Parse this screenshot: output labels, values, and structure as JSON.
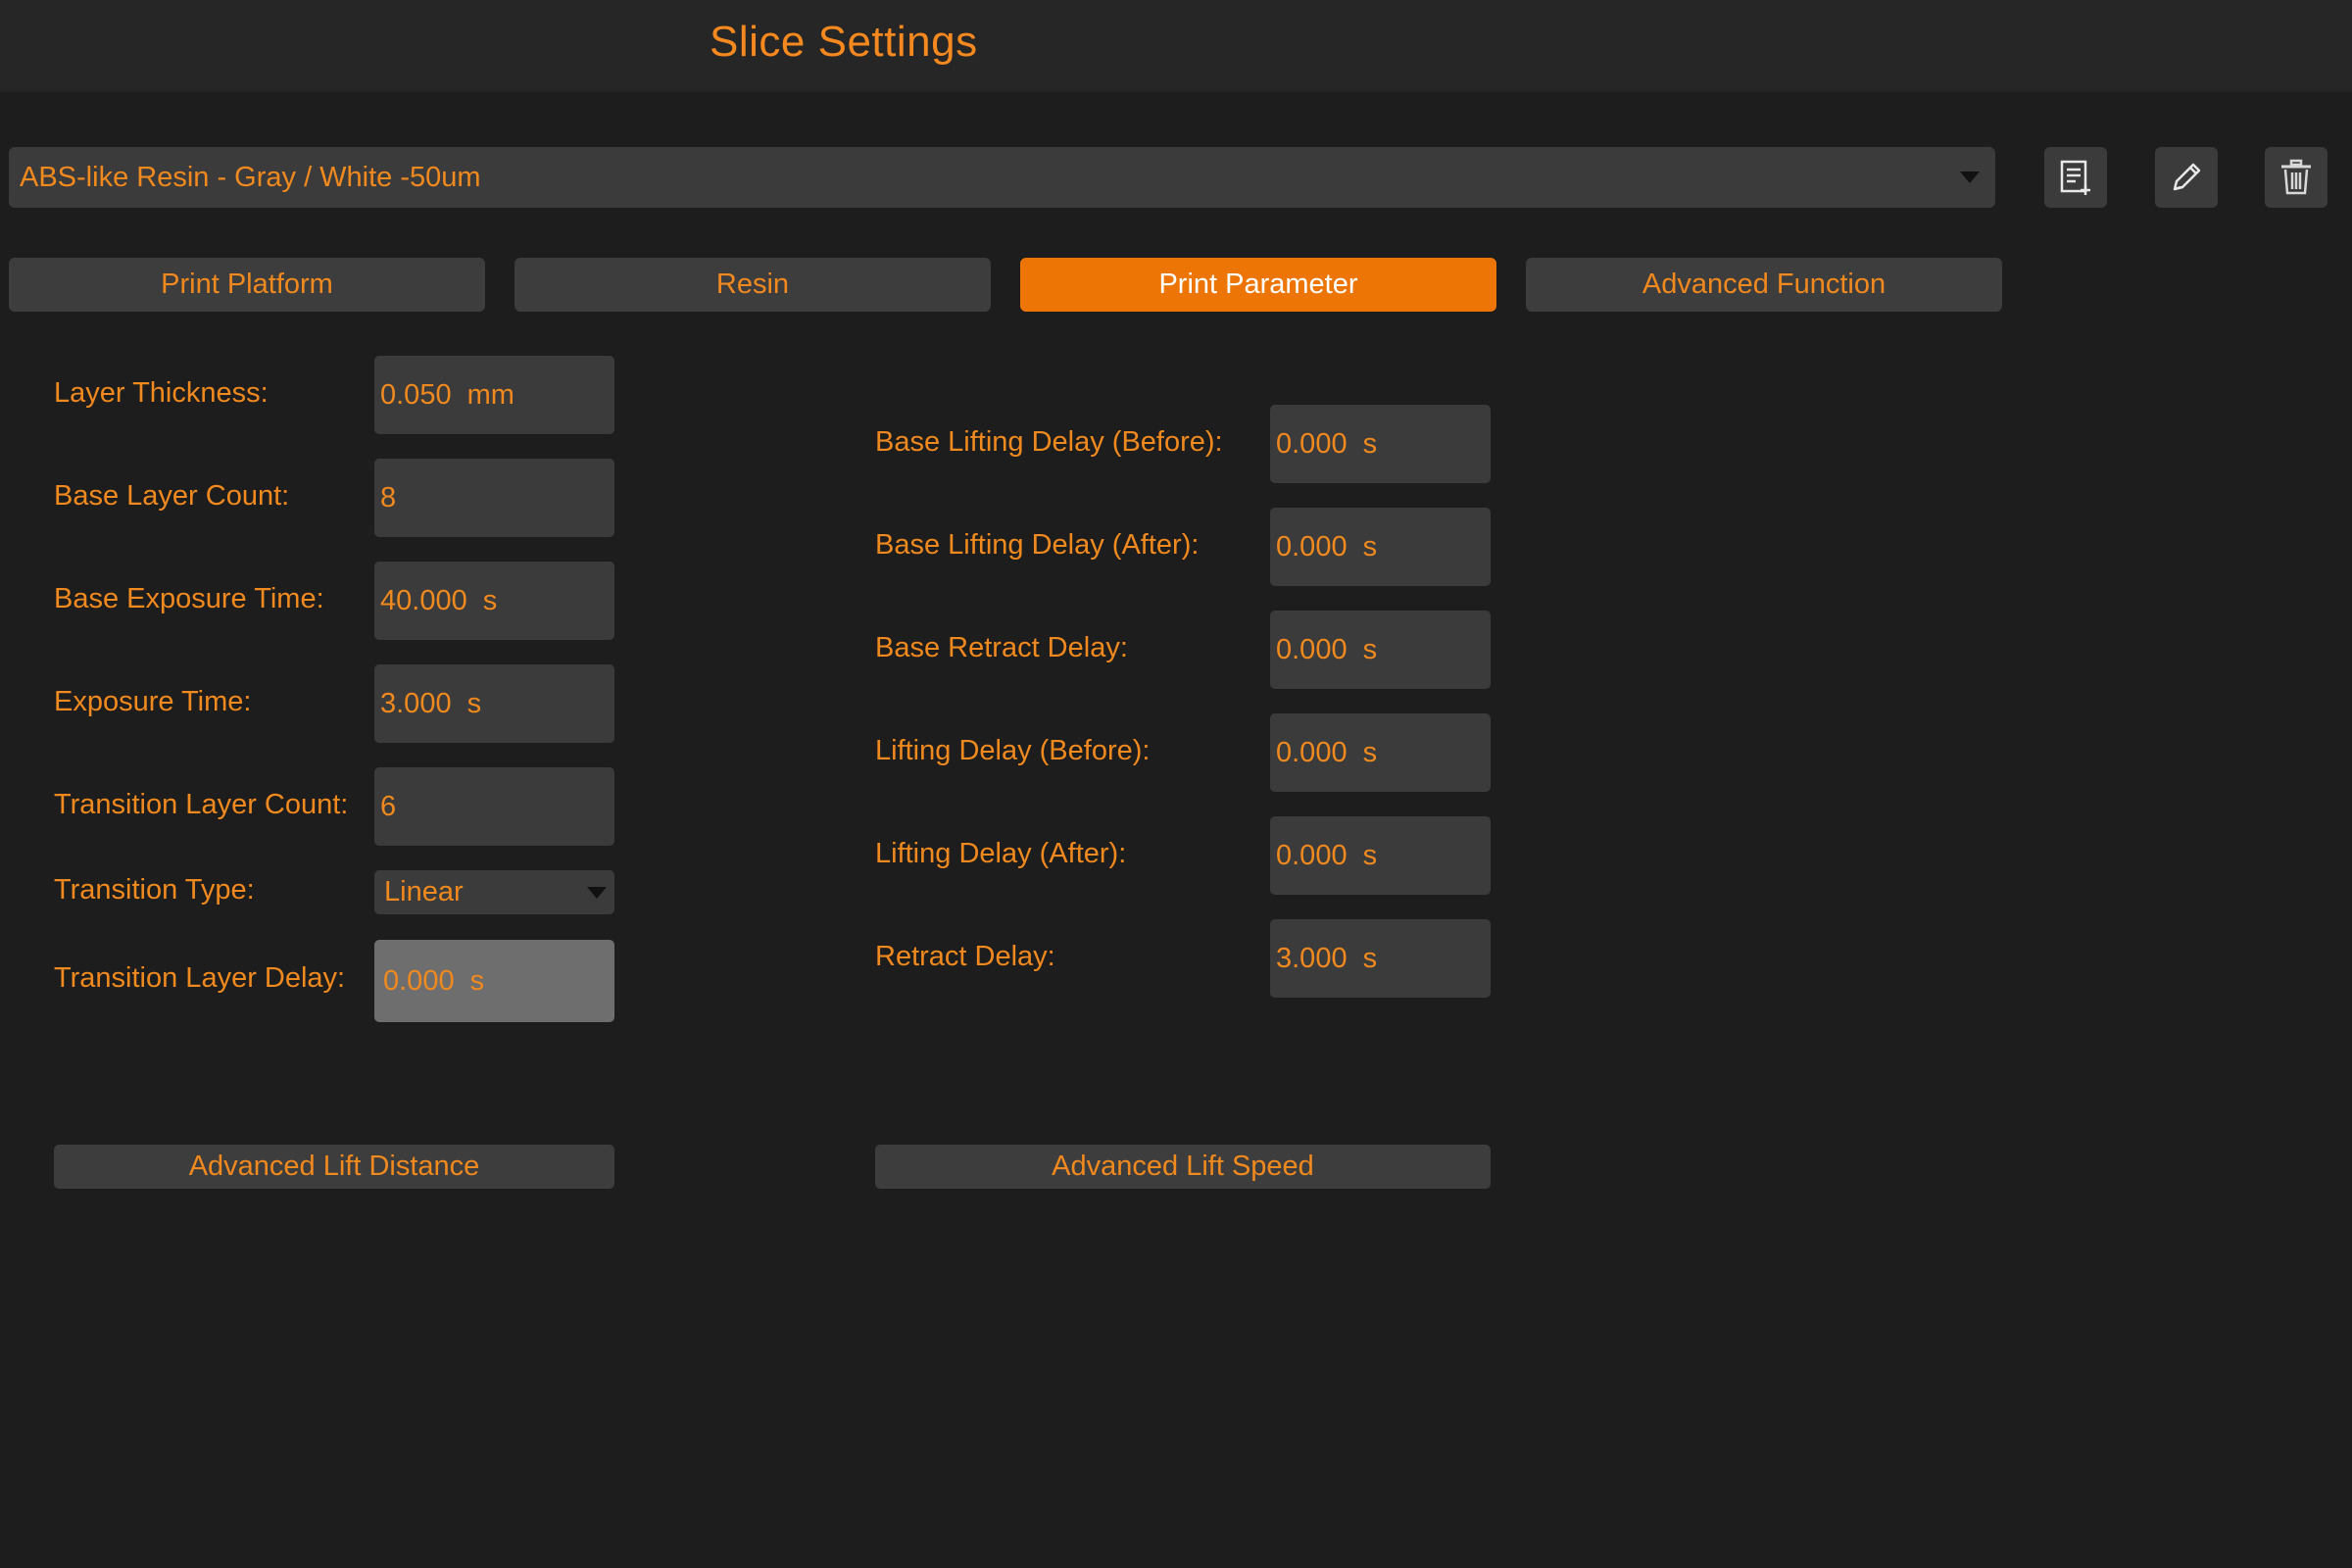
{
  "header": {
    "title": "Slice Settings"
  },
  "profile": {
    "selected": "ABS-like Resin - Gray / White -50um",
    "actions": {
      "new_icon": "new-profile-icon",
      "edit_icon": "pencil-icon",
      "delete_icon": "trash-icon"
    }
  },
  "tabs": [
    {
      "label": "Print Platform",
      "active": false
    },
    {
      "label": "Resin",
      "active": false
    },
    {
      "label": "Print Parameter",
      "active": true
    },
    {
      "label": "Advanced Function",
      "active": false
    }
  ],
  "left_fields": [
    {
      "label": "Layer Thickness:",
      "value": "0.050",
      "unit": "mm"
    },
    {
      "label": "Base Layer Count:",
      "value": "8",
      "unit": ""
    },
    {
      "label": "Base Exposure Time:",
      "value": "40.000",
      "unit": "s"
    },
    {
      "label": "Exposure Time:",
      "value": "3.000",
      "unit": "s"
    },
    {
      "label": "Transition Layer Count:",
      "value": "6",
      "unit": ""
    }
  ],
  "transition_type": {
    "label": "Transition Type:",
    "value": "Linear"
  },
  "transition_delay": {
    "label": "Transition Layer Delay:",
    "value": "0.000",
    "unit": "s",
    "disabled": true
  },
  "right_fields": [
    {
      "label": "Base Lifting Delay (Before):",
      "value": "0.000",
      "unit": "s"
    },
    {
      "label": "Base Lifting Delay (After):",
      "value": "0.000",
      "unit": "s"
    },
    {
      "label": "Base Retract Delay:",
      "value": "0.000",
      "unit": "s"
    },
    {
      "label": "Lifting Delay (Before):",
      "value": "0.000",
      "unit": "s"
    },
    {
      "label": "Lifting Delay (After):",
      "value": "0.000",
      "unit": "s"
    },
    {
      "label": "Retract Delay:",
      "value": "3.000",
      "unit": "s"
    }
  ],
  "buttons": {
    "advanced_lift_distance": "Advanced Lift Distance",
    "advanced_lift_speed": "Advanced Lift Speed"
  },
  "colors": {
    "accent": "#ec7506",
    "text": "#f0891e",
    "background": "#1d1d1e",
    "panel": "#3b3b3c"
  }
}
